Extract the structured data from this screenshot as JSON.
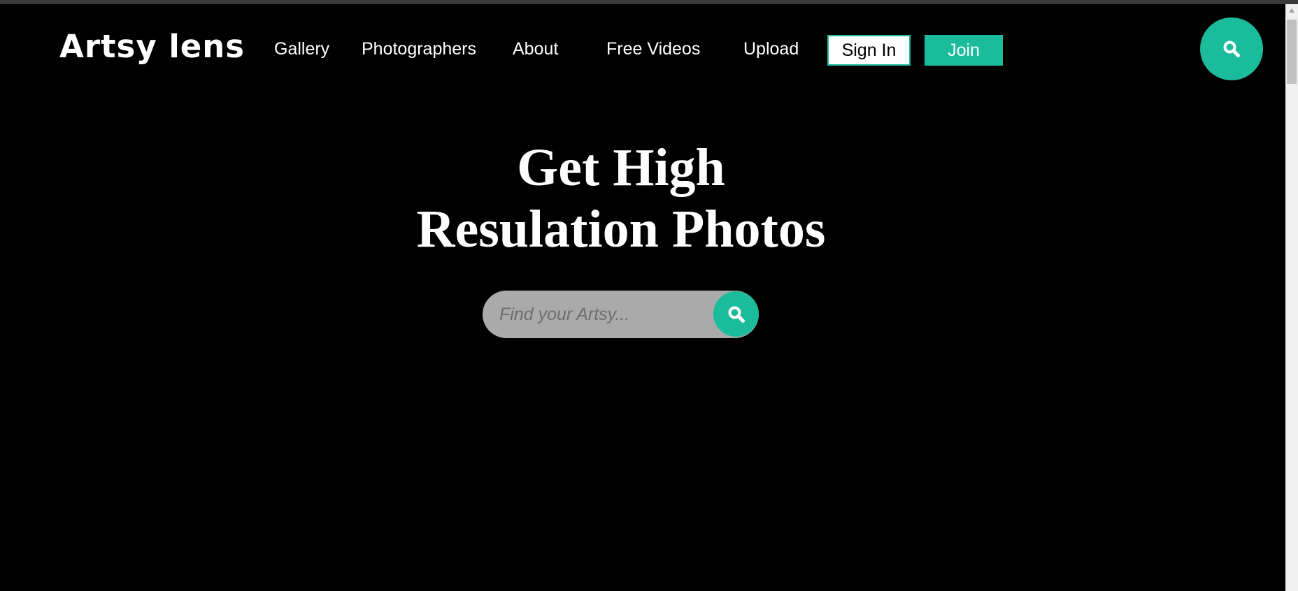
{
  "brand": {
    "logo_text": "Artsy lens"
  },
  "nav": {
    "items": [
      {
        "label": "Gallery"
      },
      {
        "label": "Photographers"
      },
      {
        "label": "About"
      },
      {
        "label": "Free Videos"
      },
      {
        "label": "Upload"
      }
    ],
    "signin_label": "Sign In",
    "join_label": "Join"
  },
  "hero": {
    "title_line1": "Get High",
    "title_line2": "Resulation Photos"
  },
  "search": {
    "placeholder": "Find your Artsy...",
    "value": ""
  },
  "icons": {
    "header_search": "search-icon",
    "bar_search": "search-icon",
    "scroll_up": "arrow-up-icon"
  },
  "colors": {
    "accent": "#1abc9c",
    "background": "#000000",
    "text": "#ffffff",
    "search_field": "#aaaaaa"
  }
}
